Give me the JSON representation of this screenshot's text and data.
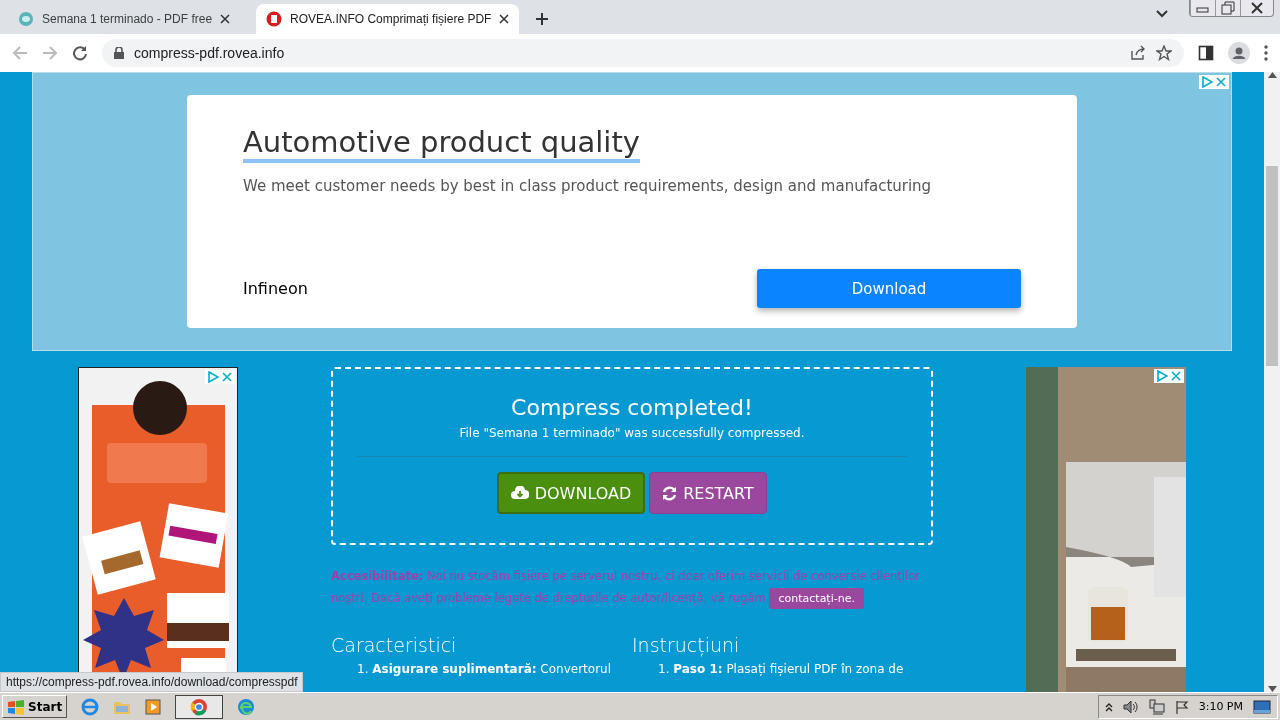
{
  "browser": {
    "tabs": [
      {
        "label": "Semana 1 terminado - PDF free",
        "selected": false
      },
      {
        "label": "ROVEA.INFO Comprimați fișiere PDF",
        "selected": true
      }
    ],
    "address": "compress-pdf.rovea.info"
  },
  "top_ad": {
    "headline": "Automotive product quality",
    "text": "We meet customer needs by best in class product requirements, design and manufacturing",
    "advertiser": "Infineon",
    "button": "Download"
  },
  "result": {
    "title": "Compress completed!",
    "message": "File \"Semana 1 terminado\" was successfully compressed.",
    "buttons": [
      {
        "kind": "download",
        "label": "DOWNLOAD"
      },
      {
        "kind": "restart",
        "label": "RESTART"
      }
    ]
  },
  "notice": {
    "text": "**Accesibilitate:** Noi nu stocăm fișiere pe serverul nostru, ci doar oferim servicii de conversie clienților noștri. Dacă aveți probleme legate de drepturile de autor/licență, vă rugăm",
    "link": "contactați-ne."
  },
  "sections": [
    {
      "title": "Caracteristici",
      "items": [
        "1. **Asigurare suplimentară:** Convertorul"
      ]
    },
    {
      "title": "Instrucțiuni",
      "items": [
        "1. **Paso 1:** Plasați fișierul PDF în zona de"
      ]
    }
  ],
  "status_url": "https://compress-pdf.rovea.info/download/compresspdf",
  "taskbar": {
    "start": "Start",
    "clock": "3:10 PM"
  }
}
